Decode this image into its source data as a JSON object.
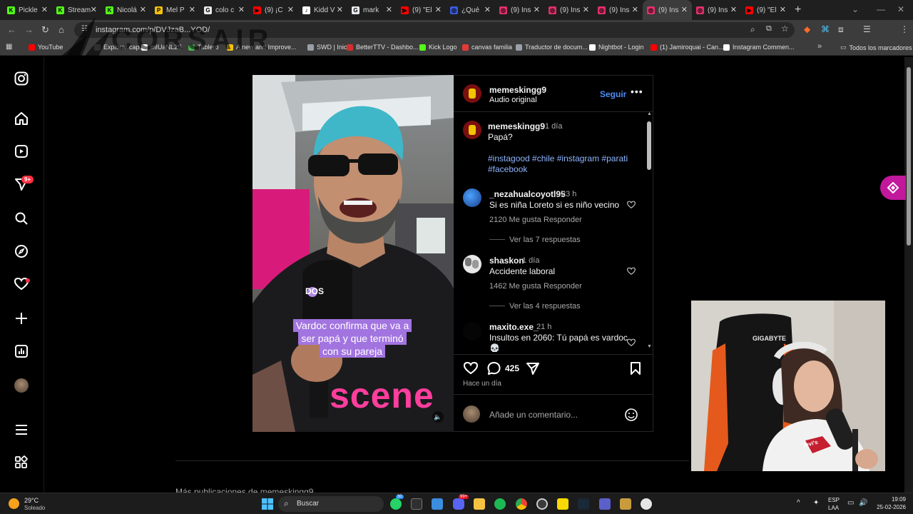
{
  "browser": {
    "tabs": [
      {
        "title": "Pickle",
        "icon_color": "#53fc18",
        "glyph": "K"
      },
      {
        "title": "Stream",
        "icon_color": "#53fc18",
        "glyph": "K"
      },
      {
        "title": "Nicolá",
        "icon_color": "#53fc18",
        "glyph": "K"
      },
      {
        "title": "Mel P",
        "icon_color": "#f4c20d",
        "glyph": "P"
      },
      {
        "title": "colo c",
        "icon_color": "#e8eaed",
        "glyph": "G"
      },
      {
        "title": "(9) ¡C",
        "icon_color": "#ff0000",
        "glyph": "▶"
      },
      {
        "title": "Kidd V",
        "icon_color": "#ffffff",
        "glyph": "♪"
      },
      {
        "title": "mark",
        "icon_color": "#e8eaed",
        "glyph": "G"
      },
      {
        "title": "(9) \"El",
        "icon_color": "#ff0000",
        "glyph": "▶"
      },
      {
        "title": "¿Qué",
        "icon_color": "#3b5bdb",
        "glyph": "◎"
      },
      {
        "title": "(9) Ins",
        "icon_color": "#e1306c",
        "glyph": "◎"
      },
      {
        "title": "(9) Ins",
        "icon_color": "#e1306c",
        "glyph": "◎"
      },
      {
        "title": "(9) Ins",
        "icon_color": "#e1306c",
        "glyph": "◎"
      },
      {
        "title": "(9) Ins",
        "icon_color": "#e1306c",
        "glyph": "◎"
      },
      {
        "title": "(9) Ins",
        "icon_color": "#e1306c",
        "glyph": "◎"
      },
      {
        "title": "(9) \"El",
        "icon_color": "#ff0000",
        "glyph": "▶"
      }
    ],
    "active_tab_index": 13,
    "url": "instagram.com/p/DVJzaB...YOD/",
    "bookmarks": [
      {
        "label": "YouTube",
        "color": "#ff0000"
      },
      {
        "label": "Explorar cap...",
        "color": "#777777"
      },
      {
        "label": "mIUaNL2S",
        "color": "#ffffff"
      },
      {
        "label": "Tablero",
        "color": "#4caf50"
      },
      {
        "label": "A new and Improve...",
        "color": "#f4c20d"
      },
      {
        "label": "SWD | Inicio",
        "color": "#9aa0a6"
      },
      {
        "label": "BetterTTV - Dashbo...",
        "color": "#d32f2f"
      },
      {
        "label": "Kick Logo",
        "color": "#53fc18"
      },
      {
        "label": "canvas familia",
        "color": "#e53935"
      },
      {
        "label": "Traductor de docum...",
        "color": "#9aa0a6"
      },
      {
        "label": "Nightbot - Login",
        "color": "#ffffff"
      },
      {
        "label": "(1) Jamiroquai - Can...",
        "color": "#ff0000"
      },
      {
        "label": "Instagram Commen...",
        "color": "#ffffff"
      }
    ],
    "all_bookmarks": "Todos los marcadores"
  },
  "watermark": {
    "brand": "CORSAIR"
  },
  "sidebar": {
    "notifications_badge": "9+"
  },
  "post": {
    "author": "memeskingg9",
    "audio": "Audio original",
    "follow": "Seguir",
    "caption_overlay": [
      "Vardoc confirma que va a",
      "ser papá y que terminó",
      "con su pareja"
    ],
    "caption": {
      "author": "memeskingg9",
      "time": "1 día",
      "text": "Papá?",
      "hashtags_line1": "#instagood #chile #instagram #parati",
      "hashtags_line2": "#facebook"
    },
    "comments": [
      {
        "user": "_nezahualcoyotl95",
        "time": "23 h",
        "text": "Si es niña Loreto si es niño vecino",
        "likes": "2120 Me gusta",
        "reply": "Responder",
        "view_replies": "Ver las 7 respuestas"
      },
      {
        "user": "shaskon",
        "time": "1 día",
        "text": "Accidente laboral",
        "likes": "1462 Me gusta",
        "reply": "Responder",
        "view_replies": "Ver las 4 respuestas"
      },
      {
        "user": "maxito.exe_",
        "time": "21 h",
        "text": "Insultos en 2060: Tú papá es vardoc",
        "extra": "💀"
      }
    ],
    "comment_count": "425",
    "posted": "Hace un día",
    "comment_placeholder": "Añade un comentario...",
    "video_text": "scene",
    "mic_text": "DOS"
  },
  "more_from": "Más publicaciones de memeskingg9",
  "webcam": {
    "chair_brand": "GIGABYTE",
    "shirt_brand": "levi's"
  },
  "taskbar": {
    "weather_temp": "29°C",
    "weather_desc": "Soleado",
    "search_label": "Buscar",
    "lang": "ESP",
    "lang2": "LAA",
    "time": "19:09",
    "date": "25-02-2026",
    "badge_a": "30",
    "badge_b": "99+"
  }
}
